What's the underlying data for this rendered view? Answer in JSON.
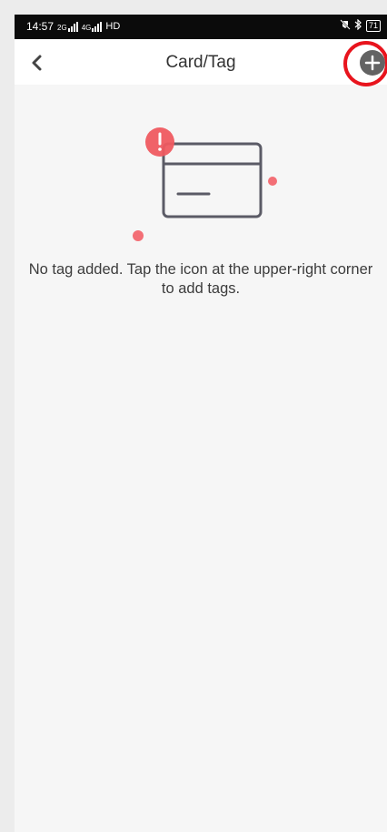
{
  "status_bar": {
    "time": "14:57",
    "network_1": "2G",
    "network_2": "4G",
    "hd_label": "HD",
    "battery": "71"
  },
  "header": {
    "title": "Card/Tag",
    "back_icon": "chevron-left-icon",
    "add_icon": "plus-circle-icon"
  },
  "empty_state": {
    "message": "No tag added. Tap the icon at the upper-right corner to add tags.",
    "illustration_icon": "card-alert-icon"
  },
  "colors": {
    "accent_red": "#e8141d",
    "alert_red": "#ef5a60",
    "icon_gray": "#636363",
    "card_stroke": "#5b5b66"
  }
}
